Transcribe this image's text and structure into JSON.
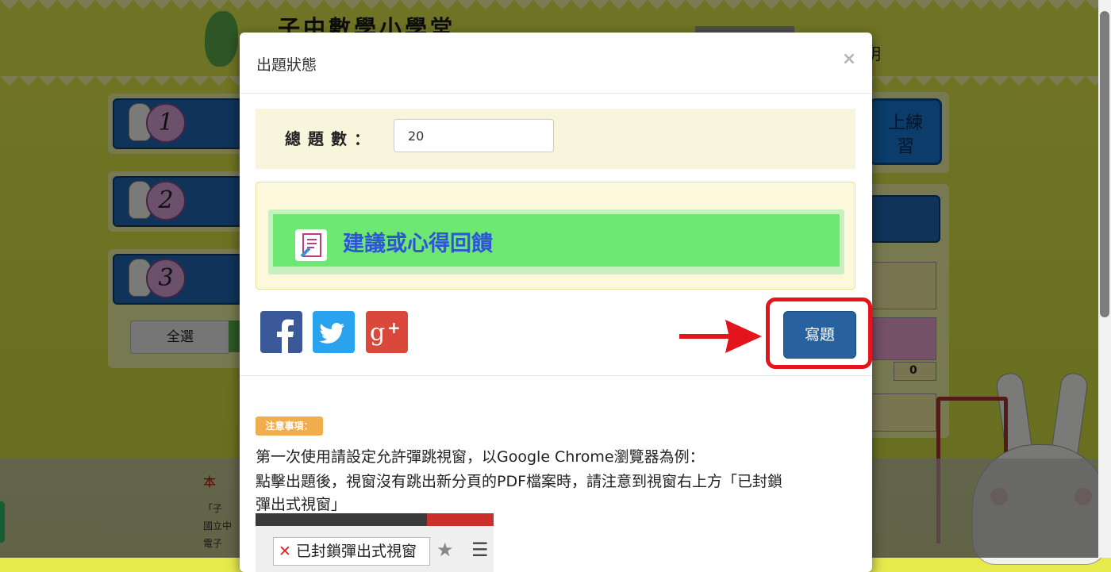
{
  "background": {
    "site_title": "子中數學小學堂",
    "help_link": "明",
    "practice_button": "上練\n習",
    "unit_numbers": [
      "1",
      "2",
      "3"
    ],
    "select_all_button": "全選",
    "score_value": "0",
    "footer_text": [
      "本",
      "「子",
      "國立中",
      "電子"
    ]
  },
  "modal": {
    "title": "出題狀態",
    "close_glyph": "×",
    "count_label": "總題數：",
    "count_value": "20",
    "feedback_button": "建議或心得回饋",
    "write_button": "寫題",
    "notice_badge": "注意事項：",
    "notice_lines": [
      "第一次使用請設定允許彈跳視窗，以Google Chrome瀏覽器為例：",
      "點擊出題後，視窗沒有跳出新分頁的PDF檔案時，請注意到視窗右上方「已封鎖",
      "彈出式視窗」"
    ],
    "blocked_popup_label": "已封鎖彈出式視窗"
  },
  "social": {
    "facebook": "facebook-icon",
    "twitter": "twitter-icon",
    "googleplus": "google-plus-icon",
    "facebook_color": "#3b5998",
    "twitter_color": "#2aa3ef",
    "googleplus_color": "#d9483b"
  },
  "colors": {
    "accent_highlight": "#e3141b",
    "primary_button": "#27619f",
    "feedback_green": "#6de872"
  }
}
